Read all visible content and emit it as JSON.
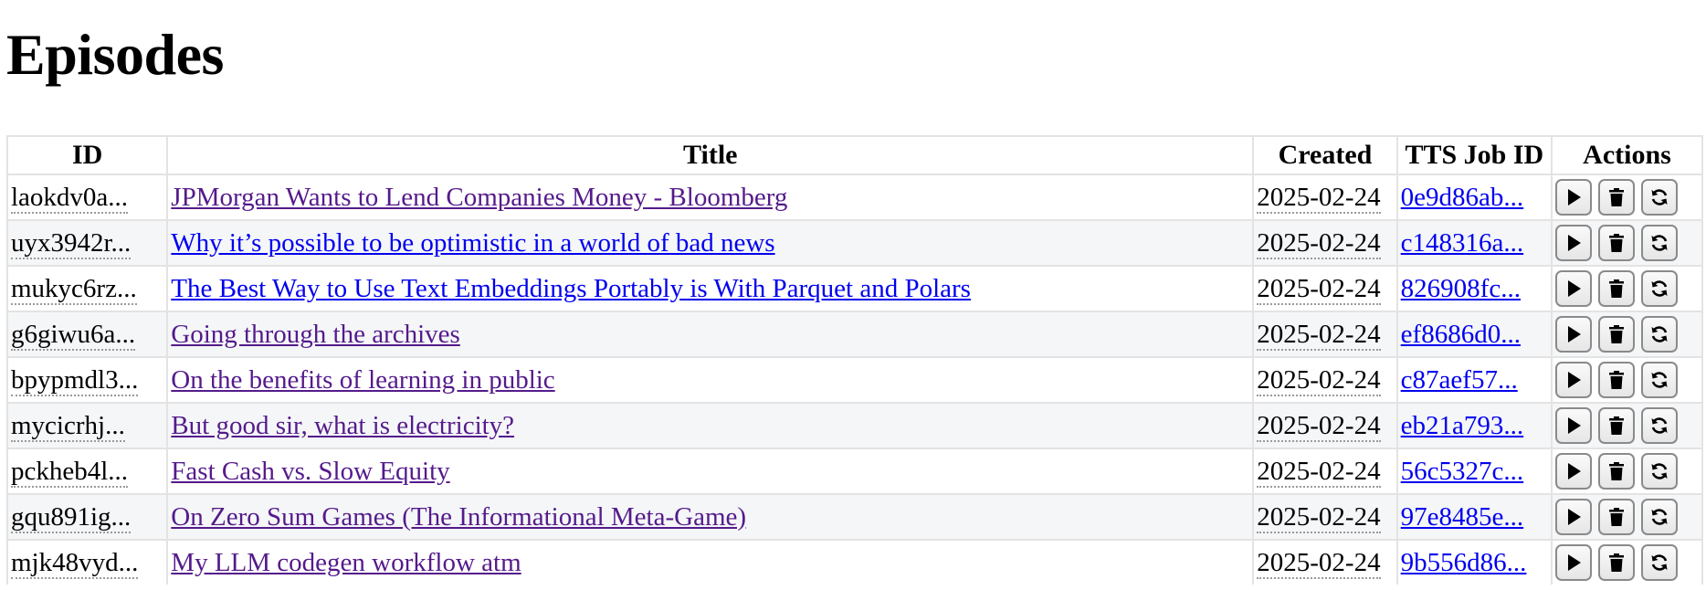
{
  "page": {
    "title": "Episodes"
  },
  "table": {
    "headers": {
      "id": "ID",
      "title": "Title",
      "created": "Created",
      "tts_job_id": "TTS Job ID",
      "actions": "Actions"
    },
    "rows": [
      {
        "id": "laokdv0a...",
        "title": "JPMorgan Wants to Lend Companies Money - Bloomberg",
        "created": "2025-02-24",
        "tts_job_id": "0e9d86ab...",
        "visited": true
      },
      {
        "id": "uyx3942r...",
        "title": "Why it’s possible to be optimistic in a world of bad news",
        "created": "2025-02-24",
        "tts_job_id": "c148316a...",
        "visited": false
      },
      {
        "id": "mukyc6rz...",
        "title": "The Best Way to Use Text Embeddings Portably is With Parquet and Polars",
        "created": "2025-02-24",
        "tts_job_id": "826908fc...",
        "visited": false
      },
      {
        "id": "g6giwu6a...",
        "title": "Going through the archives",
        "created": "2025-02-24",
        "tts_job_id": "ef8686d0...",
        "visited": true
      },
      {
        "id": "bpypmdl3...",
        "title": "On the benefits of learning in public",
        "created": "2025-02-24",
        "tts_job_id": "c87aef57...",
        "visited": true
      },
      {
        "id": "mycicrhj...",
        "title": "But good sir, what is electricity?",
        "created": "2025-02-24",
        "tts_job_id": "eb21a793...",
        "visited": true
      },
      {
        "id": "pckheb4l...",
        "title": "Fast Cash vs. Slow Equity",
        "created": "2025-02-24",
        "tts_job_id": "56c5327c...",
        "visited": true
      },
      {
        "id": "gqu891ig...",
        "title": "On Zero Sum Games (The Informational Meta-Game)",
        "created": "2025-02-24",
        "tts_job_id": "97e8485e...",
        "visited": true
      },
      {
        "id": "mjk48vyd...",
        "title": "My LLM codegen workflow atm",
        "created": "2025-02-24",
        "tts_job_id": "9b556d86...",
        "visited": true
      }
    ],
    "actions": [
      "play-icon",
      "trash-icon",
      "refresh-icon"
    ]
  },
  "colors": {
    "link_visited": "#551a8b",
    "link_unvisited": "#0000ee",
    "row_alt_bg": "#f4f6f8",
    "border": "#e3e3e3"
  }
}
